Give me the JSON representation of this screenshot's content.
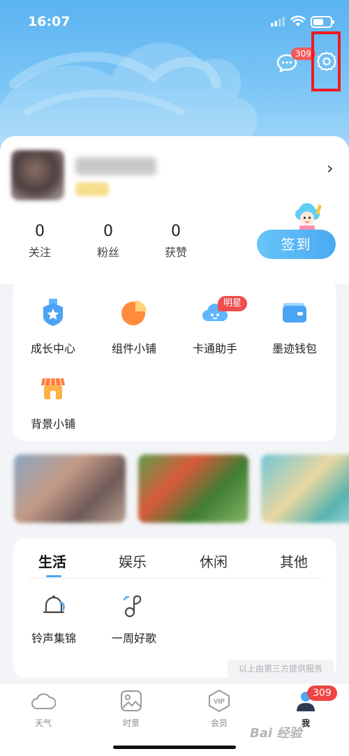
{
  "status_bar": {
    "time": "16:07"
  },
  "header": {
    "message_badge": "309"
  },
  "profile": {
    "stats": [
      {
        "value": "0",
        "label": "关注"
      },
      {
        "value": "0",
        "label": "粉丝"
      },
      {
        "value": "0",
        "label": "获赞"
      }
    ],
    "checkin_label": "签到"
  },
  "services": [
    {
      "label": "成长中心",
      "icon": "medal-icon"
    },
    {
      "label": "组件小铺",
      "icon": "pie-chart-icon"
    },
    {
      "label": "卡通助手",
      "icon": "cartoon-cloud-icon",
      "badge": "明星"
    },
    {
      "label": "墨迹钱包",
      "icon": "wallet-icon"
    },
    {
      "label": "背景小铺",
      "icon": "shop-icon"
    }
  ],
  "tabs": [
    {
      "label": "生活",
      "active": true
    },
    {
      "label": "娱乐",
      "active": false
    },
    {
      "label": "休闲",
      "active": false
    },
    {
      "label": "其他",
      "active": false
    }
  ],
  "tools": [
    {
      "label": "铃声集锦",
      "icon": "bell-icon"
    },
    {
      "label": "一周好歌",
      "icon": "music-note-icon"
    }
  ],
  "third_party_note": "以上由第三方提供服务",
  "bottom_nav": {
    "items": [
      {
        "label": "天气",
        "icon": "cloud-icon",
        "active": false
      },
      {
        "label": "时景",
        "icon": "picture-icon",
        "active": false
      },
      {
        "label": "会员",
        "icon": "vip-icon",
        "active": false
      },
      {
        "label": "我",
        "icon": "user-icon",
        "active": true
      }
    ],
    "badge": "309"
  },
  "watermark": "Bai 经验",
  "colors": {
    "accent": "#4aa9f2",
    "badge": "#ee4444",
    "highlight": "#ee1b23"
  }
}
